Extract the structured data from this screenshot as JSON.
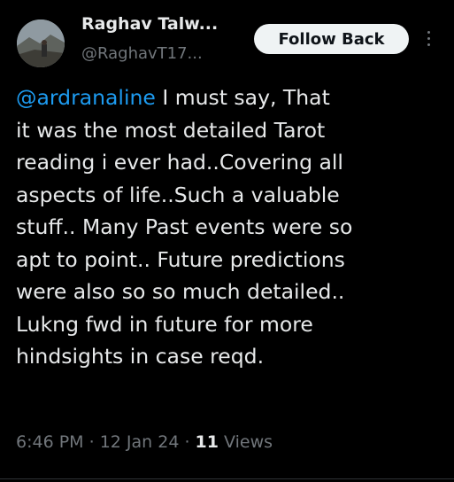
{
  "author": {
    "name": "Raghav Talw...",
    "handle": "@RaghavT17..."
  },
  "follow_button": {
    "label": "Follow Back"
  },
  "tweet": {
    "mention": "@ardranaline",
    "lines": [
      " I must say, That",
      "it was the most detailed Tarot",
      "reading i ever had..Covering all",
      "aspects of life..Such a valuable",
      "stuff.. Many Past events were so",
      "apt to point.. Future predictions",
      "were also so so much detailed..",
      "Lukng fwd in future for more",
      "hindsights in case reqd."
    ]
  },
  "meta": {
    "time": "6:46 PM",
    "date": "12 Jan 24",
    "separator": " · ",
    "views_count": "11",
    "views_label": " Views"
  },
  "icons": {
    "more": "more-vertical-icon"
  },
  "colors": {
    "background": "#000000",
    "text": "#e7e9ea",
    "secondary": "#71767b",
    "link": "#1d9bf0",
    "button_bg": "#eff3f4"
  }
}
